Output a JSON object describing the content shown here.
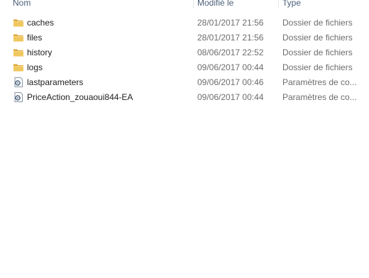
{
  "columns": {
    "name": "Nom",
    "modified": "Modifié le",
    "type": "Type"
  },
  "files": [
    {
      "icon": "folder-icon",
      "name": "caches",
      "modified": "28/01/2017 21:56",
      "type": "Dossier de fichiers"
    },
    {
      "icon": "folder-icon",
      "name": "files",
      "modified": "28/01/2017 21:56",
      "type": "Dossier de fichiers"
    },
    {
      "icon": "folder-icon",
      "name": "history",
      "modified": "08/06/2017 22:52",
      "type": "Dossier de fichiers"
    },
    {
      "icon": "folder-icon",
      "name": "logs",
      "modified": "09/06/2017 00:44",
      "type": "Dossier de fichiers"
    },
    {
      "icon": "settings-file-icon",
      "name": "lastparameters",
      "modified": "09/06/2017 00:46",
      "type": "Paramètres de co..."
    },
    {
      "icon": "settings-file-icon",
      "name": "PriceAction_zouaoui844-EA",
      "modified": "09/06/2017 00:44",
      "type": "Paramètres de co..."
    }
  ],
  "colors": {
    "header_text": "#4c607a",
    "folder_yellow": "#e8b84a",
    "secondary_text": "#6d6d6d"
  }
}
